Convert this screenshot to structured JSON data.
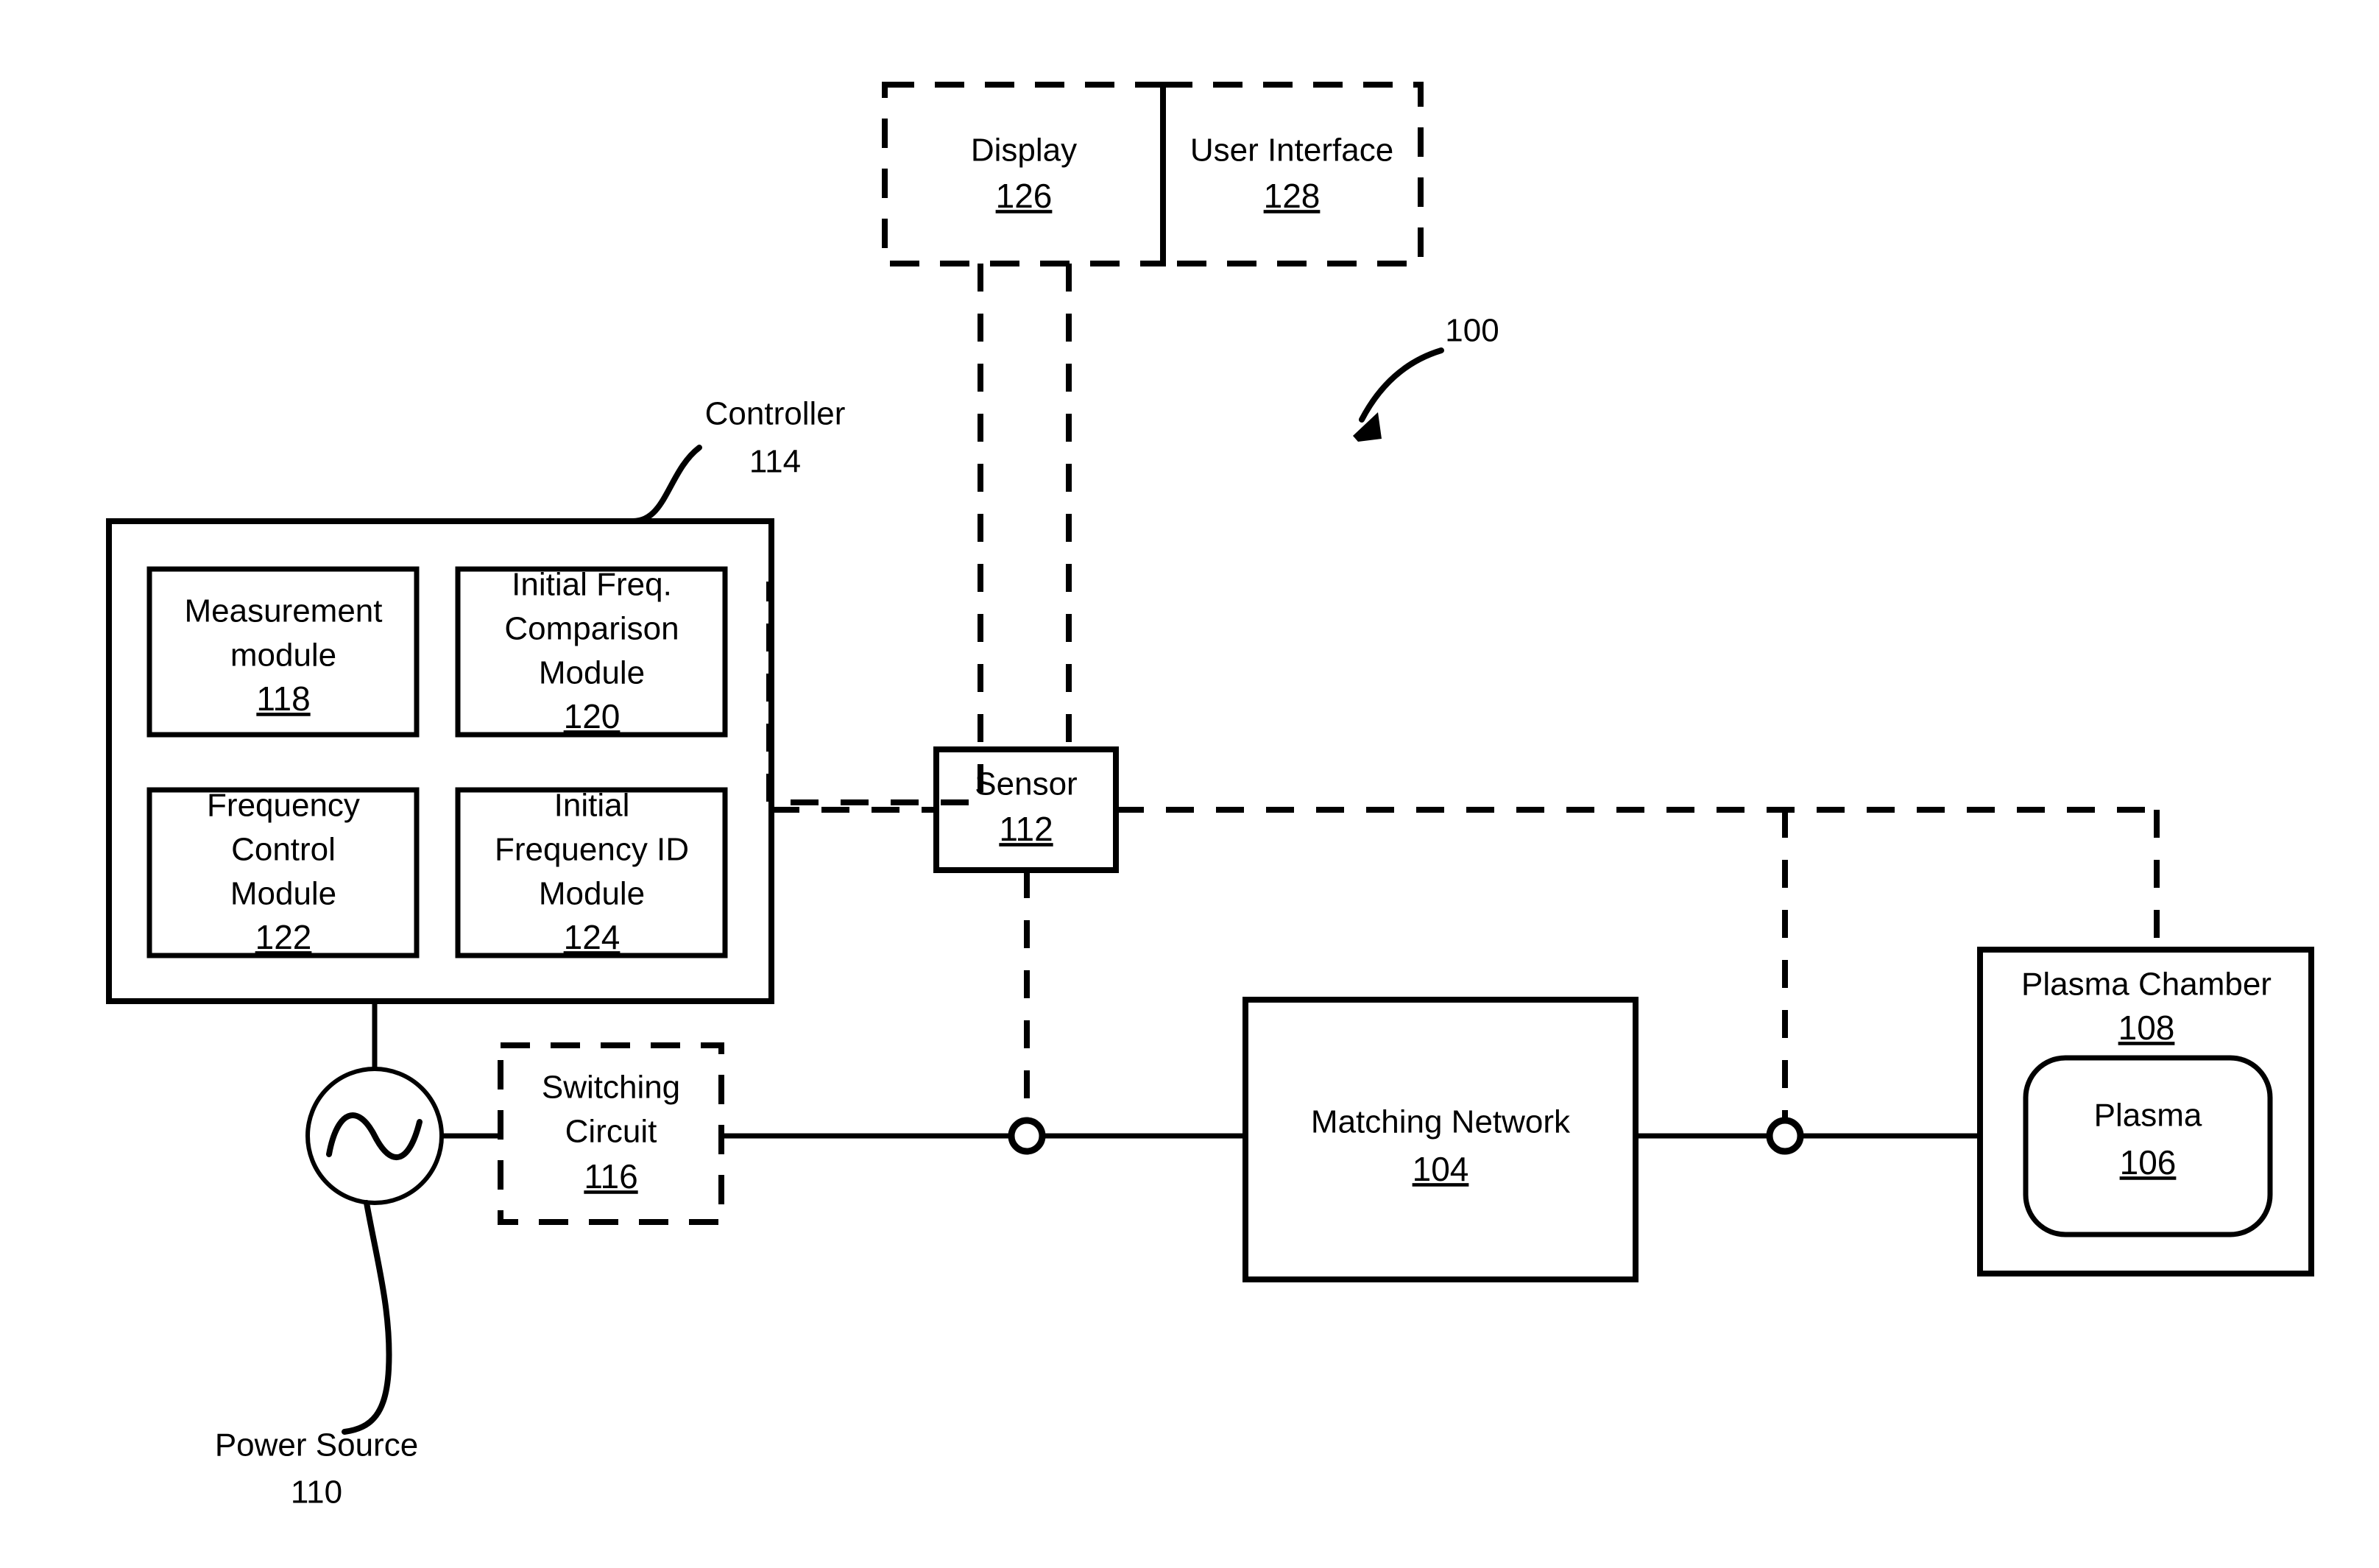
{
  "figure": {
    "system_ref": "100"
  },
  "blocks": {
    "display": {
      "label": "Display",
      "ref": "126"
    },
    "user_interface": {
      "label": "User Interface",
      "ref": "128"
    },
    "controller": {
      "label": "Controller",
      "ref": "114"
    },
    "measurement_module": {
      "line1": "Measurement",
      "line2": "module",
      "ref": "118"
    },
    "initial_freq_comparison_module": {
      "line1": "Initial Freq.",
      "line2": "Comparison",
      "line3": "Module",
      "ref": "120"
    },
    "frequency_control_module": {
      "line1": "Frequency",
      "line2": "Control",
      "line3": "Module",
      "ref": "122"
    },
    "initial_frequency_id_module": {
      "line1": "Initial",
      "line2": "Frequency ID",
      "line3": "Module",
      "ref": "124"
    },
    "sensor": {
      "label": "Sensor",
      "ref": "112"
    },
    "switching_circuit": {
      "line1": "Switching",
      "line2": "Circuit",
      "ref": "116"
    },
    "matching_network": {
      "label": "Matching Network",
      "ref": "104"
    },
    "plasma_chamber": {
      "label": "Plasma Chamber",
      "ref": "108"
    },
    "plasma": {
      "label": "Plasma",
      "ref": "106"
    },
    "power_source": {
      "line1": "Power Source",
      "ref": "110"
    }
  },
  "colors": {
    "ink": "#000000",
    "paper": "#ffffff"
  }
}
